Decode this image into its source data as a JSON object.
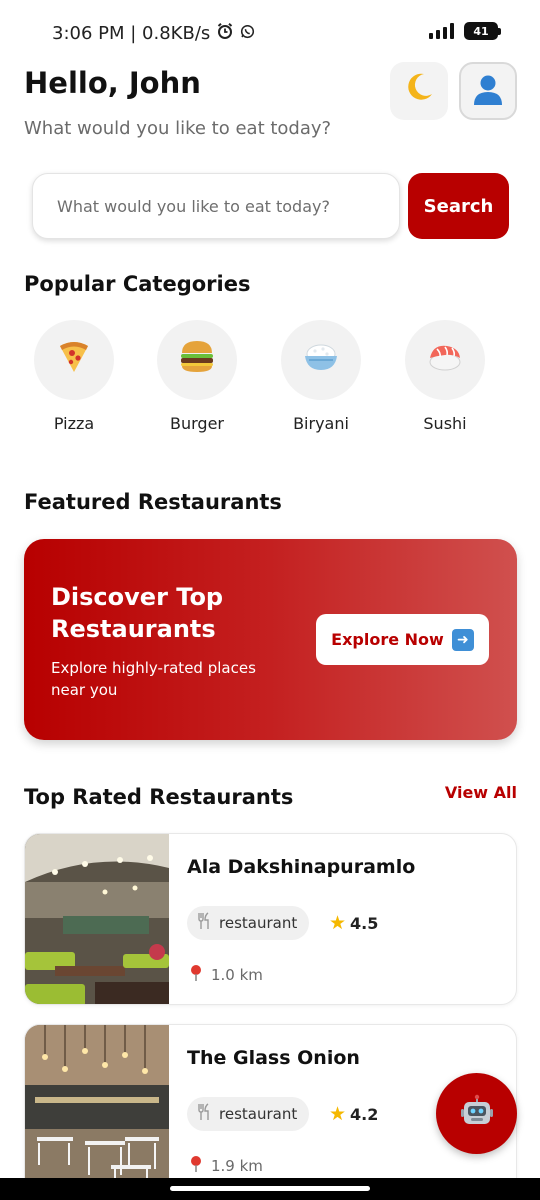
{
  "status": {
    "time_speed": "3:06 PM | 0.8KB/s",
    "battery": "41",
    "alarm_icon": "alarm-clock-icon",
    "whatsapp_icon": "whatsapp-icon"
  },
  "header": {
    "greeting": "Hello, John",
    "subtitle": "What would you like to eat today?",
    "theme_icon": "moon-icon",
    "profile_icon": "user-icon"
  },
  "search": {
    "placeholder": "What would you like to eat today?",
    "button_label": "Search"
  },
  "categories": {
    "title": "Popular Categories",
    "items": [
      {
        "label": "Pizza",
        "icon": "pizza-icon"
      },
      {
        "label": "Burger",
        "icon": "burger-icon"
      },
      {
        "label": "Biryani",
        "icon": "rice-bowl-icon"
      },
      {
        "label": "Sushi",
        "icon": "sushi-icon"
      }
    ]
  },
  "featured": {
    "title": "Featured Restaurants",
    "banner_title": "Discover Top Restaurants",
    "banner_subtitle": "Explore highly-rated places near you",
    "button_label": "Explore Now",
    "gradient_start": "#b70000",
    "gradient_end": "#d0504e"
  },
  "top_rated": {
    "title": "Top Rated Restaurants",
    "view_all": "View All",
    "restaurants": [
      {
        "name": "Ala Dakshinapuramlo",
        "tag": "restaurant",
        "rating": "4.5",
        "distance": "1.0 km"
      },
      {
        "name": "The Glass Onion",
        "tag": "restaurant",
        "rating": "4.2",
        "distance": "1.9 km"
      }
    ]
  },
  "fab_icon": "robot-icon",
  "accent_color": "#b80000"
}
